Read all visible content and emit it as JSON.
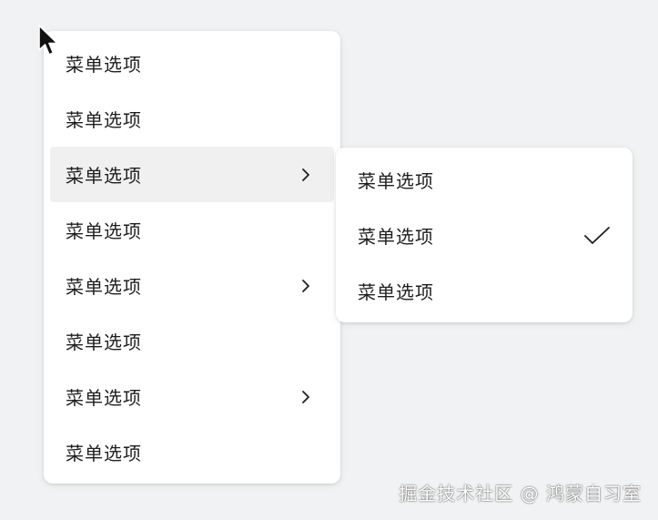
{
  "main_menu": {
    "items": [
      {
        "label": "菜单选项",
        "has_submenu": false,
        "hovered": false
      },
      {
        "label": "菜单选项",
        "has_submenu": false,
        "hovered": false
      },
      {
        "label": "菜单选项",
        "has_submenu": true,
        "hovered": true
      },
      {
        "label": "菜单选项",
        "has_submenu": false,
        "hovered": false
      },
      {
        "label": "菜单选项",
        "has_submenu": true,
        "hovered": false
      },
      {
        "label": "菜单选项",
        "has_submenu": false,
        "hovered": false
      },
      {
        "label": "菜单选项",
        "has_submenu": true,
        "hovered": false
      },
      {
        "label": "菜单选项",
        "has_submenu": false,
        "hovered": false
      }
    ]
  },
  "sub_menu": {
    "items": [
      {
        "label": "菜单选项",
        "checked": false
      },
      {
        "label": "菜单选项",
        "checked": true
      },
      {
        "label": "菜单选项",
        "checked": false
      }
    ]
  },
  "watermark": "掘金技术社区 @ 鸿蒙自习室",
  "colors": {
    "background": "#f1f2f3",
    "menu_bg": "#ffffff",
    "hover_bg": "#f0f0f0",
    "text": "#1f1f1f"
  },
  "icons": {
    "submenu_indicator": "chevron-right-icon",
    "selected_indicator": "checkmark-icon",
    "pointer": "mouse-cursor-icon"
  }
}
